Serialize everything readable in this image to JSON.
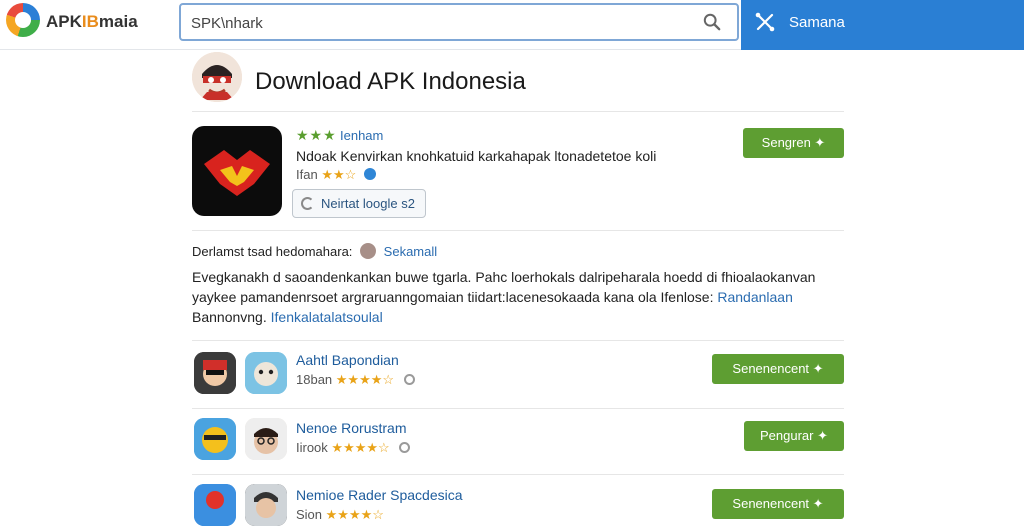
{
  "header": {
    "logo_text_a": "APK",
    "logo_text_b": "IB",
    "logo_text_c": "maia",
    "search_value": "SPK\\nhark",
    "right_label": "Samana"
  },
  "page": {
    "title": "Download APK Indonesia"
  },
  "featured": {
    "stars": "★★★",
    "name": "Ienham",
    "description": "Ndoak Kenvirkan knohkatuid karkahapak ltonadetetoe koli",
    "meta_label": "Ifan",
    "meta_stars": "★★☆",
    "outline_button": "Neirtat loogle s2",
    "download_button": "Sengren ✦"
  },
  "info": {
    "prefix": "Derlamst tsad hedomahara:",
    "link": "Sekamall"
  },
  "paragraph": {
    "line1": "Evegkanakh d saoandenkankan buwe tgarla. Pahc loerhokals dalripeharala hoedd di fhioalaokanvan",
    "line2_text": "yaykee pamandenrsoet argraruanngomaian tiidart:lacenesokaada kana ola Ifenlose:",
    "line2_link": "Randanlaan",
    "line3_text": "Bannonvng.",
    "line3_link": "Ifenkalatalatsoulal"
  },
  "rows": [
    {
      "title": "Aahtl Bapondian",
      "meta_label": "18ban",
      "stars": "★★★★☆",
      "button": "Senenencent ✦"
    },
    {
      "title": "Nenoe Rorustram",
      "meta_label": "Iirook",
      "stars": "★★★★☆",
      "button": "Pengurar ✦"
    },
    {
      "title": "Nemioe Rader Spacdesica",
      "meta_label": "Sion",
      "stars": "★★★★☆",
      "button": "Senenencent ✦"
    }
  ],
  "colors": {
    "brand_blue": "#2a7fd4",
    "download_green": "#5e9e32",
    "star_gold": "#e9a318",
    "link_blue": "#2b6cb0"
  },
  "icons": [
    "logo-icon",
    "search-icon",
    "sync-icon",
    "avatar",
    "verified-icon",
    "loading-icon",
    "info-icon"
  ]
}
